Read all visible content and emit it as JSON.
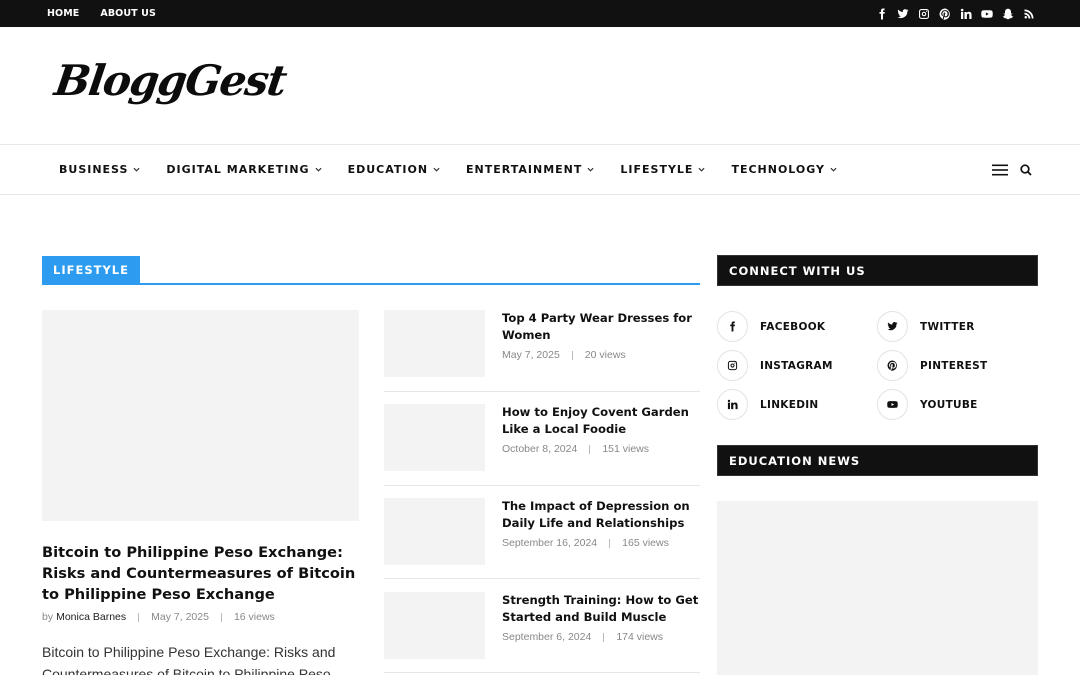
{
  "topbar": {
    "links": [
      "HOME",
      "ABOUT US"
    ],
    "social_icons": [
      "facebook-icon",
      "twitter-icon",
      "instagram-icon",
      "pinterest-icon",
      "linkedin-icon",
      "youtube-icon",
      "snapchat-icon",
      "rss-icon"
    ]
  },
  "header": {
    "logo_text": "BloggGest"
  },
  "nav": {
    "items": [
      "BUSINESS",
      "DIGITAL MARKETING",
      "EDUCATION",
      "ENTERTAINMENT",
      "LIFESTYLE",
      "TECHNOLOGY"
    ]
  },
  "section": {
    "label": "LIFESTYLE",
    "accent": "#2d9cf0"
  },
  "featured": {
    "title": "Bitcoin to Philippine Peso Exchange: Risks and Countermeasures of Bitcoin to Philippine Peso Exchange",
    "by": "by",
    "author": "Monica Barnes",
    "date": "May 7, 2025",
    "views": "16 views",
    "excerpt": "Bitcoin to Philippine Peso Exchange: Risks and Countermeasures of Bitcoin to Philippine Peso"
  },
  "posts": [
    {
      "title": "Top 4 Party Wear Dresses for Women",
      "date": "May 7, 2025",
      "views": "20 views"
    },
    {
      "title": "How to Enjoy Covent Garden Like a Local Foodie",
      "date": "October 8, 2024",
      "views": "151 views"
    },
    {
      "title": "The Impact of Depression on Daily Life and Relationships",
      "date": "September 16, 2024",
      "views": "165 views"
    },
    {
      "title": "Strength Training: How to Get Started and Build Muscle",
      "date": "September 6, 2024",
      "views": "174 views"
    }
  ],
  "sidebar": {
    "connect_title": "CONNECT WITH US",
    "social": [
      {
        "label": "FACEBOOK",
        "icon": "facebook-icon"
      },
      {
        "label": "TWITTER",
        "icon": "twitter-icon"
      },
      {
        "label": "INSTAGRAM",
        "icon": "instagram-icon"
      },
      {
        "label": "PINTEREST",
        "icon": "pinterest-icon"
      },
      {
        "label": "LINKEDIN",
        "icon": "linkedin-icon"
      },
      {
        "label": "YOUTUBE",
        "icon": "youtube-icon"
      }
    ],
    "education_title": "EDUCATION NEWS"
  }
}
